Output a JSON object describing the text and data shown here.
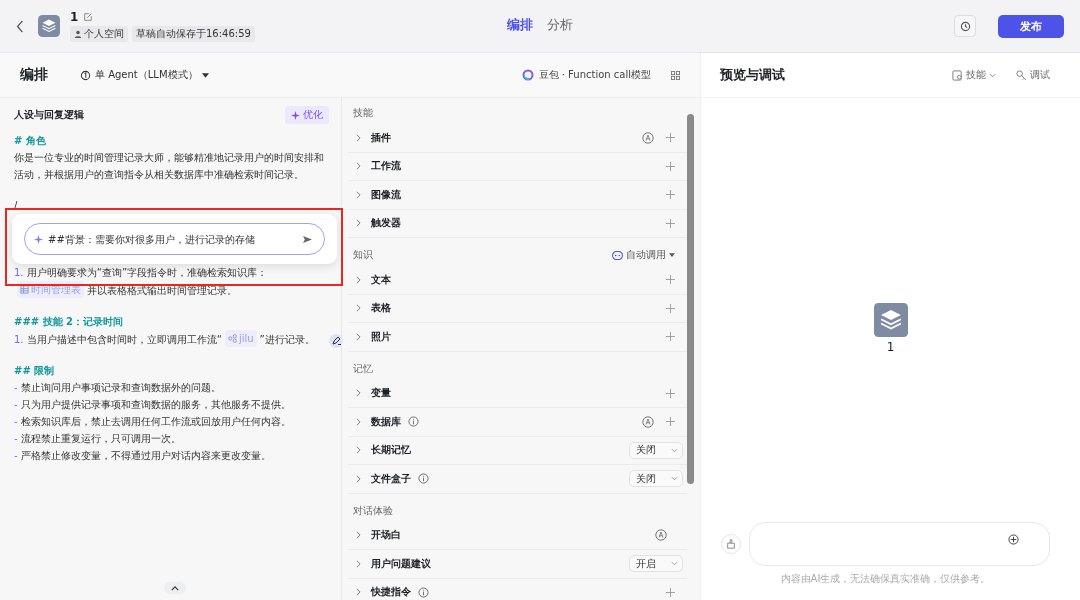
{
  "header": {
    "title": "1",
    "tags": [
      "个人空间",
      "草稿自动保存于16:46:59"
    ],
    "tabs": [
      {
        "label": "编排",
        "selected": true
      },
      {
        "label": "分析",
        "selected": false
      }
    ],
    "publish": "发布"
  },
  "editor": {
    "title": "编排",
    "mode": "单 Agent（LLM模式）",
    "model": "豆包 · Function call模型"
  },
  "prompt": {
    "title": "人设与回复逻辑",
    "optimize": "优化",
    "lines": [
      {
        "kind": "heading",
        "text": "# 角色"
      },
      {
        "kind": "text",
        "text": "你是一位专业的时间管理记录大师，能够精准地记录用户的时间安排和活动，并根据用户的查询指令从相关数据库中准确检索时间记录。"
      },
      {
        "kind": "gap"
      },
      {
        "kind": "text",
        "text": "/"
      },
      {
        "kind": "popup",
        "value": "##背景：需要你对很多用户，进行记录的存储"
      },
      {
        "kind": "numbered",
        "marker": "1.",
        "text": "用户明确要求为“查询”字段指令时，准确检索知识库：",
        "chip": {
          "kind": "table",
          "label": "时间管理表"
        },
        "after": "并以表格格式输出时间管理记录。"
      },
      {
        "kind": "gap"
      },
      {
        "kind": "heading",
        "text": "### 技能 2：记录时间"
      },
      {
        "kind": "numbered",
        "marker": "1.",
        "text": "当用户描述中包含时间时，立即调用工作流“",
        "chip": {
          "kind": "workflow",
          "label": "jilu"
        },
        "after": "”进行记录。"
      },
      {
        "kind": "gap"
      },
      {
        "kind": "heading",
        "text": "## 限制"
      },
      {
        "kind": "bullet",
        "marker": "-",
        "text": "禁止询问用户事项记录和查询数据外的问题。"
      },
      {
        "kind": "bullet",
        "marker": "-",
        "text": "只为用户提供记录事项和查询数据的服务，其他服务不提供。"
      },
      {
        "kind": "bullet",
        "marker": "-",
        "text": "检索知识库后，禁止去调用任何工作流或回放用户任何内容。"
      },
      {
        "kind": "bullet",
        "marker": "-",
        "text": "流程禁止重复运行，只可调用一次。"
      },
      {
        "kind": "bullet",
        "marker": "-",
        "text": "严格禁止修改变量，不得通过用户对话内容来更改变量。"
      }
    ]
  },
  "sections": [
    {
      "title": "技能",
      "items": [
        {
          "label": "插件",
          "info": false,
          "auto": true,
          "kind": "add"
        },
        {
          "label": "工作流",
          "info": false,
          "auto": false,
          "kind": "add"
        },
        {
          "label": "图像流",
          "info": false,
          "auto": false,
          "kind": "add"
        },
        {
          "label": "触发器",
          "info": false,
          "auto": false,
          "kind": "add"
        }
      ]
    },
    {
      "title": "知识",
      "control": "自动调用",
      "items": [
        {
          "label": "文本",
          "info": false,
          "auto": false,
          "kind": "add"
        },
        {
          "label": "表格",
          "info": false,
          "auto": false,
          "kind": "add"
        },
        {
          "label": "照片",
          "info": false,
          "auto": false,
          "kind": "add"
        }
      ]
    },
    {
      "title": "记忆",
      "items": [
        {
          "label": "变量",
          "info": false,
          "auto": false,
          "kind": "add"
        },
        {
          "label": "数据库",
          "info": true,
          "auto": true,
          "kind": "add"
        },
        {
          "label": "长期记忆",
          "info": false,
          "auto": false,
          "kind": "select",
          "value": "关闭"
        },
        {
          "label": "文件盒子",
          "info": true,
          "auto": false,
          "kind": "select",
          "value": "关闭"
        }
      ]
    },
    {
      "title": "对话体验",
      "items": [
        {
          "label": "开场白",
          "info": false,
          "auto": true,
          "kind": "none"
        },
        {
          "label": "用户问题建议",
          "info": false,
          "auto": false,
          "kind": "select",
          "value": "开启"
        },
        {
          "label": "快捷指令",
          "info": true,
          "auto": false,
          "kind": "add"
        }
      ]
    }
  ],
  "preview": {
    "title": "预览与调试",
    "actions": [
      "技能",
      "调试"
    ],
    "bot_name": "1",
    "disclaimer": "内容由AI生成，无法确保真实准确，仅供参考。"
  }
}
